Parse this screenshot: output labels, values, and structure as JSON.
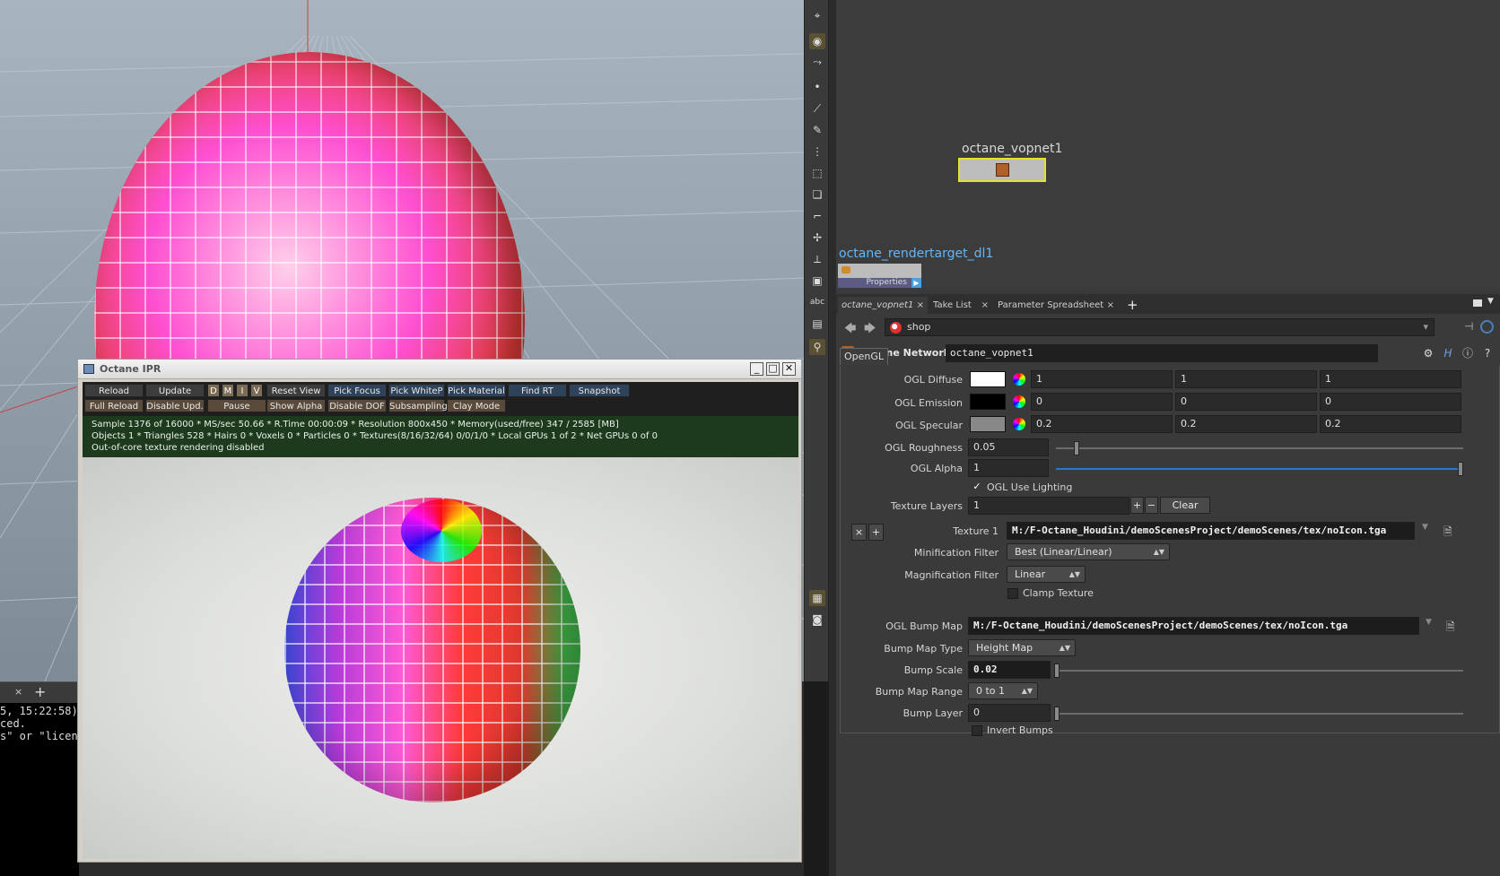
{
  "ipr": {
    "title": "Octane IPR",
    "buttons_row1": [
      "Reload",
      "Update",
      "D",
      "M",
      "I",
      "V",
      "Reset View",
      "Pick Focus",
      "Pick WhiteP",
      "Pick Material",
      "Find RT",
      "Snapshot"
    ],
    "buttons_row2": [
      "Full Reload",
      "Disable Upd.",
      "Pause",
      "Show Alpha",
      "Disable DOF",
      "Subsampling",
      "Clay Mode"
    ],
    "status": [
      "Sample 1376 of 16000 * MS/sec 50.66 * R.Time 00:00:09 * Resolution 800x450 * Memory(used/free) 347 / 2585 [MB]",
      "Objects 1 * Triangles 528 * Hairs 0 * Voxels 0 * Particles 0 * Textures(8/16/32/64) 0/0/1/0 * Local GPUs 1 of 2 * Net GPUs 0 of 0",
      "Out-of-core texture rendering disabled"
    ]
  },
  "console": {
    "close": "×",
    "add": "+",
    "lines": [
      "5, 15:22:58)",
      "ced.",
      "s\" or \"licens"
    ]
  },
  "network": {
    "node1_name": "octane_vopnet1",
    "node2_name": "octane_rendertarget_dl1",
    "node2_badge": "Properties"
  },
  "pane": {
    "tabs": [
      {
        "label": "octane_vopnet1",
        "close": "×"
      },
      {
        "label": "Take List",
        "close": "×"
      },
      {
        "label": "Parameter Spreadsheet",
        "close": "×"
      }
    ],
    "add_tab": "+",
    "path": "shop",
    "node_type": "Octane Network",
    "node_name": "octane_vopnet1",
    "folder_tab": "OpenGL"
  },
  "params": {
    "ogl_diffuse": {
      "label": "OGL Diffuse",
      "color": "#ffffff",
      "values": [
        "1",
        "1",
        "1"
      ]
    },
    "ogl_emission": {
      "label": "OGL Emission",
      "color": "#000000",
      "values": [
        "0",
        "0",
        "0"
      ]
    },
    "ogl_specular": {
      "label": "OGL Specular",
      "color": "#888888",
      "values": [
        "0.2",
        "0.2",
        "0.2"
      ]
    },
    "ogl_roughness": {
      "label": "OGL Roughness",
      "value": "0.05"
    },
    "ogl_alpha": {
      "label": "OGL Alpha",
      "value": "1"
    },
    "use_lighting": {
      "label": "OGL Use Lighting",
      "checked": "✓"
    },
    "texture_layers": {
      "label": "Texture Layers",
      "value": "1",
      "plus": "+",
      "minus": "−",
      "clear": "Clear"
    },
    "multi_remove": "×",
    "multi_add": "+",
    "texture1": {
      "label": "Texture 1",
      "value": "M:/F-Octane_Houdini/demoScenesProject/demoScenes/tex/noIcon.tga"
    },
    "min_filter": {
      "label": "Minification Filter",
      "value": "Best (Linear/Linear)"
    },
    "mag_filter": {
      "label": "Magnification Filter",
      "value": "Linear"
    },
    "clamp_texture": {
      "label": "Clamp Texture"
    },
    "bump_map": {
      "label": "OGL Bump Map",
      "value": "M:/F-Octane_Houdini/demoScenesProject/demoScenes/tex/noIcon.tga"
    },
    "bump_map_type": {
      "label": "Bump Map Type",
      "value": "Height Map"
    },
    "bump_scale": {
      "label": "Bump Scale",
      "value": "0.02"
    },
    "bump_map_range": {
      "label": "Bump Map Range",
      "value": "0 to 1"
    },
    "bump_layer": {
      "label": "Bump Layer",
      "value": "0"
    },
    "invert_bumps": {
      "label": "Invert Bumps"
    }
  }
}
